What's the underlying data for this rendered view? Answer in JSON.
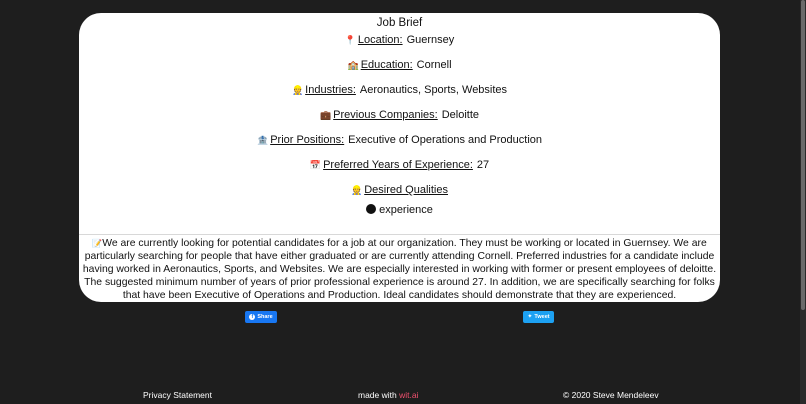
{
  "card": {
    "title": "Job Brief",
    "fields": [
      {
        "emoji": "📍",
        "label": "Location:",
        "value": "Guernsey"
      },
      {
        "emoji": "🏫",
        "label": "Education:",
        "value": "Cornell"
      },
      {
        "emoji": "👷",
        "label": "Industries:",
        "value": "Aeronautics, Sports, Websites"
      },
      {
        "emoji": "💼",
        "label": "Previous Companies:",
        "value": "Deloitte"
      },
      {
        "emoji": "🏦",
        "label": "Prior Positions:",
        "value": "Executive of Operations and Production"
      },
      {
        "emoji": "📅",
        "label": "Preferred Years of Experience:",
        "value": "27"
      }
    ],
    "qualities": {
      "emoji": "👷",
      "label": "Desired Qualities",
      "items": [
        "experience"
      ]
    },
    "summary_emoji": "📝",
    "summary": "We are currently looking for potential candidates for a job at our organization. They must be working or located in Guernsey. We are particularly searching for people that have either graduated or are currently attending Cornell. Preferred industries for a candidate include having worked in Aeronautics, Sports, and Websites. We are especially interested in working with former or present employees of deloitte. The suggested minimum number of years of prior professional experience is around 27. In addition, we are specifically searching for folks that have been Executive of Operations and Production. Ideal candidates should demonstrate that they are experienced."
  },
  "share": {
    "facebook_label": "Share",
    "twitter_label": "Tweet",
    "facebook_color": "#1877f2",
    "twitter_color": "#1da1f2"
  },
  "footer": {
    "privacy": "Privacy Statement",
    "made_with_prefix": "made with ",
    "made_with_brand": "wit.ai",
    "copyright": "© 2020 Steve Mendeleev",
    "brand_color": "#f0506e"
  }
}
